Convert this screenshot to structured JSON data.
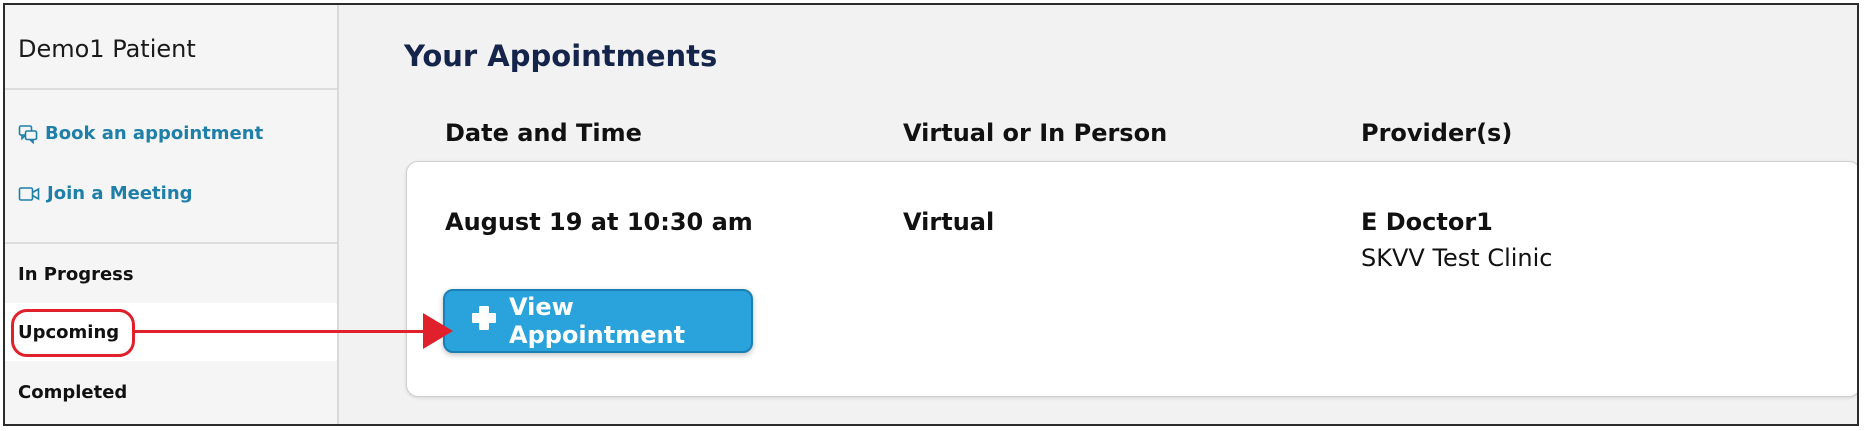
{
  "sidebar": {
    "user_name": "Demo1 Patient",
    "links": [
      {
        "label": "Book an appointment",
        "icon": "chat-bubbles-icon"
      },
      {
        "label": "Join a Meeting",
        "icon": "video-camera-icon"
      }
    ],
    "filters": [
      {
        "label": "In Progress",
        "active": false
      },
      {
        "label": "Upcoming",
        "active": true
      },
      {
        "label": "Completed",
        "active": false
      }
    ]
  },
  "main": {
    "title": "Your Appointments",
    "columns": [
      "Date and Time",
      "Virtual or In Person",
      "Provider(s)"
    ],
    "appointments": [
      {
        "date_time": "August 19 at 10:30 am",
        "mode": "Virtual",
        "provider": "E Doctor1",
        "clinic": "SKVV Test Clinic",
        "button_label": "View Appointment",
        "button_icon": "plus-icon"
      }
    ]
  },
  "colors": {
    "accent": "#2aa3dc",
    "link": "#1e7fa8",
    "title": "#14244a",
    "annotation": "#e0202b"
  }
}
